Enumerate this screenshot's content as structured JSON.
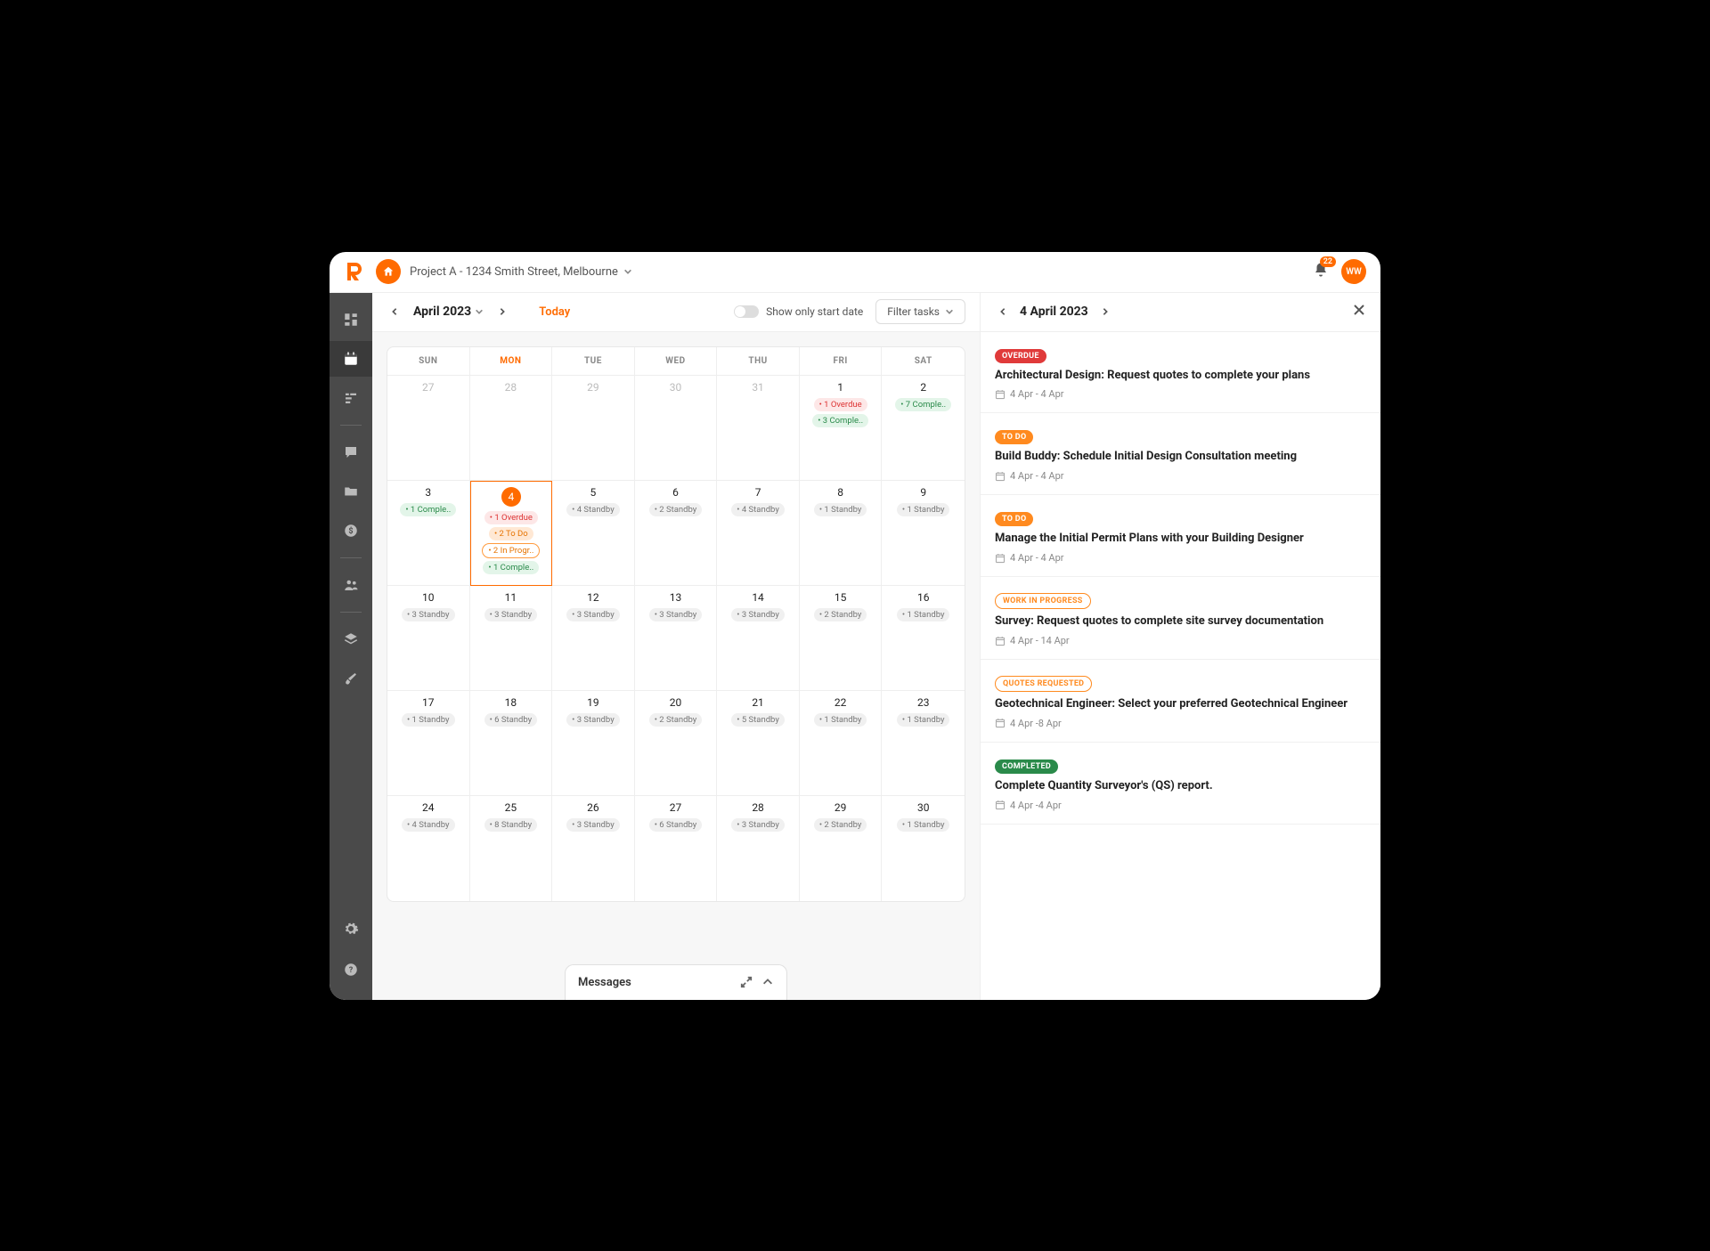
{
  "project_name": "Project A - 1234 Smith Street, Melbourne",
  "notification_count": "22",
  "avatar_initials": "WW",
  "month_label": "April 2023",
  "today_label": "Today",
  "show_only_start_label": "Show only start date",
  "filter_label": "Filter tasks",
  "day_headers": [
    "SUN",
    "MON",
    "TUE",
    "WED",
    "THU",
    "FRI",
    "SAT"
  ],
  "active_day_header_index": 1,
  "weeks": [
    [
      {
        "num": "27",
        "prev": true,
        "pills": []
      },
      {
        "num": "28",
        "prev": true,
        "pills": []
      },
      {
        "num": "29",
        "prev": true,
        "pills": []
      },
      {
        "num": "30",
        "prev": true,
        "pills": []
      },
      {
        "num": "31",
        "prev": true,
        "pills": []
      },
      {
        "num": "1",
        "pills": [
          {
            "type": "overdue",
            "text": "• 1 Overdue"
          },
          {
            "type": "complete",
            "text": "• 3 Comple.."
          }
        ]
      },
      {
        "num": "2",
        "pills": [
          {
            "type": "complete",
            "text": "• 7 Comple.."
          }
        ]
      }
    ],
    [
      {
        "num": "3",
        "pills": [
          {
            "type": "complete",
            "text": "• 1 Comple.."
          }
        ]
      },
      {
        "num": "4",
        "selected": true,
        "pills": [
          {
            "type": "overdue",
            "text": "• 1 Overdue"
          },
          {
            "type": "todo",
            "text": "• 2 To Do"
          },
          {
            "type": "progress",
            "text": "• 2 In Progr.."
          },
          {
            "type": "complete",
            "text": "• 1 Comple.."
          }
        ]
      },
      {
        "num": "5",
        "pills": [
          {
            "type": "standby",
            "text": "• 4 Standby"
          }
        ]
      },
      {
        "num": "6",
        "pills": [
          {
            "type": "standby",
            "text": "• 2 Standby"
          }
        ]
      },
      {
        "num": "7",
        "pills": [
          {
            "type": "standby",
            "text": "• 4 Standby"
          }
        ]
      },
      {
        "num": "8",
        "pills": [
          {
            "type": "standby",
            "text": "• 1 Standby"
          }
        ]
      },
      {
        "num": "9",
        "pills": [
          {
            "type": "standby",
            "text": "• 1 Standby"
          }
        ]
      }
    ],
    [
      {
        "num": "10",
        "pills": [
          {
            "type": "standby",
            "text": "• 3 Standby"
          }
        ]
      },
      {
        "num": "11",
        "pills": [
          {
            "type": "standby",
            "text": "• 3 Standby"
          }
        ]
      },
      {
        "num": "12",
        "pills": [
          {
            "type": "standby",
            "text": "• 3 Standby"
          }
        ]
      },
      {
        "num": "13",
        "pills": [
          {
            "type": "standby",
            "text": "• 3 Standby"
          }
        ]
      },
      {
        "num": "14",
        "pills": [
          {
            "type": "standby",
            "text": "• 3 Standby"
          }
        ]
      },
      {
        "num": "15",
        "pills": [
          {
            "type": "standby",
            "text": "• 2 Standby"
          }
        ]
      },
      {
        "num": "16",
        "pills": [
          {
            "type": "standby",
            "text": "• 1 Standby"
          }
        ]
      }
    ],
    [
      {
        "num": "17",
        "pills": [
          {
            "type": "standby",
            "text": "• 1 Standby"
          }
        ]
      },
      {
        "num": "18",
        "pills": [
          {
            "type": "standby",
            "text": "• 6 Standby"
          }
        ]
      },
      {
        "num": "19",
        "pills": [
          {
            "type": "standby",
            "text": "• 3 Standby"
          }
        ]
      },
      {
        "num": "20",
        "pills": [
          {
            "type": "standby",
            "text": "• 2 Standby"
          }
        ]
      },
      {
        "num": "21",
        "pills": [
          {
            "type": "standby",
            "text": "• 5 Standby"
          }
        ]
      },
      {
        "num": "22",
        "pills": [
          {
            "type": "standby",
            "text": "• 1 Standby"
          }
        ]
      },
      {
        "num": "23",
        "pills": [
          {
            "type": "standby",
            "text": "• 1 Standby"
          }
        ]
      }
    ],
    [
      {
        "num": "24",
        "pills": [
          {
            "type": "standby",
            "text": "• 4 Standby"
          }
        ]
      },
      {
        "num": "25",
        "pills": [
          {
            "type": "standby",
            "text": "• 8 Standby"
          }
        ]
      },
      {
        "num": "26",
        "pills": [
          {
            "type": "standby",
            "text": "• 3 Standby"
          }
        ]
      },
      {
        "num": "27",
        "pills": [
          {
            "type": "standby",
            "text": "• 6 Standby"
          }
        ]
      },
      {
        "num": "28",
        "pills": [
          {
            "type": "standby",
            "text": "• 3 Standby"
          }
        ]
      },
      {
        "num": "29",
        "pills": [
          {
            "type": "standby",
            "text": "• 2 Standby"
          }
        ]
      },
      {
        "num": "30",
        "pills": [
          {
            "type": "standby",
            "text": "• 1 Standby"
          }
        ]
      }
    ]
  ],
  "messages_label": "Messages",
  "detail_date": "4 April 2023",
  "tasks": [
    {
      "status": "OVERDUE",
      "status_class": "tag-overdue",
      "title": "Architectural Design: Request quotes to complete your plans",
      "dates": "4 Apr - 4 Apr"
    },
    {
      "status": "TO DO",
      "status_class": "tag-todo",
      "title": "Build Buddy: Schedule Initial Design Consultation meeting",
      "dates": "4 Apr - 4 Apr"
    },
    {
      "status": "TO DO",
      "status_class": "tag-todo",
      "title": "Manage the Initial Permit Plans with your Building Designer",
      "dates": "4 Apr - 4 Apr"
    },
    {
      "status": "WORK IN PROGRESS",
      "status_class": "tag-progress",
      "title": "Survey: Request quotes to complete site survey documentation",
      "dates": "4 Apr - 14 Apr"
    },
    {
      "status": "QUOTES REQUESTED",
      "status_class": "tag-quotes",
      "title": "Geotechnical Engineer: Select your preferred Geotechnical Engineer",
      "dates": "4 Apr -8 Apr"
    },
    {
      "status": "COMPLETED",
      "status_class": "tag-complete",
      "title": "Complete Quantity Surveyor's (QS) report.",
      "dates": "4 Apr -4 Apr"
    }
  ]
}
